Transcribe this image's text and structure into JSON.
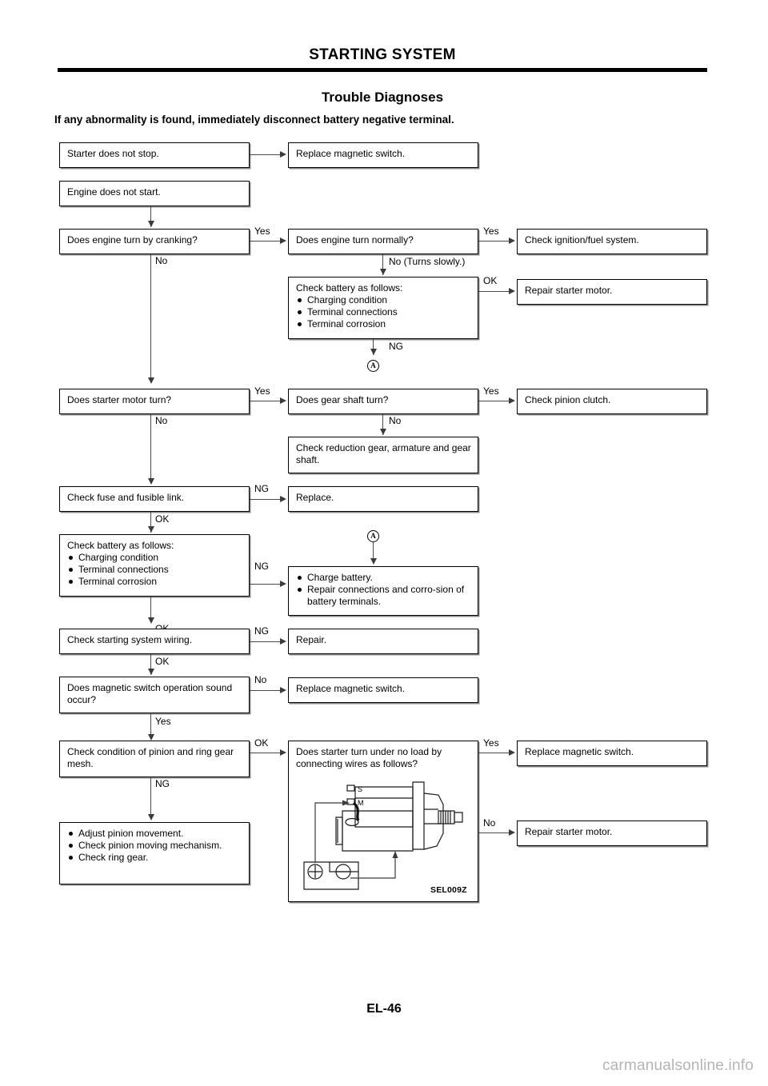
{
  "document": {
    "header_title": "STARTING SYSTEM",
    "section_title": "Trouble Diagnoses",
    "intro": "If any abnormality is found, immediately disconnect battery negative terminal.",
    "page_number": "EL-46",
    "watermark": "carmanualsonline.info"
  },
  "boxes": {
    "starter_does_not_stop": "Starter does not stop.",
    "replace_magnetic_switch_1": "Replace magnetic switch.",
    "engine_does_not_start": "Engine does not start.",
    "does_engine_turn_by_cranking": "Does engine turn by cranking?",
    "does_engine_turn_normally": "Does engine turn normally?",
    "check_ignition_fuel_system": "Check ignition/fuel system.",
    "check_battery_1_title": "Check battery as follows:",
    "check_battery_1_items": [
      "Charging condition",
      "Terminal connections",
      "Terminal corrosion"
    ],
    "repair_starter_motor_1": "Repair starter motor.",
    "does_starter_motor_turn": "Does starter motor turn?",
    "does_gear_shaft_turn": "Does gear shaft turn?",
    "check_pinion_clutch": "Check pinion clutch.",
    "check_reduction_gear": "Check reduction gear, armature and gear shaft.",
    "check_fuse_and_fusible_link": "Check fuse and fusible link.",
    "replace": "Replace.",
    "check_battery_2_title": "Check battery as follows:",
    "check_battery_2_items": [
      "Charging condition",
      "Terminal connections",
      "Terminal corrosion"
    ],
    "charge_battery_items": [
      "Charge battery.",
      "Repair connections and corro-­sion of battery terminals."
    ],
    "check_starting_system_wiring": "Check starting system wiring.",
    "repair": "Repair.",
    "does_magnetic_switch_sound": "Does magnetic switch operation sound occur?",
    "replace_magnetic_switch_2": "Replace magnetic switch.",
    "check_pinion_ring_gear_mesh": "Check condition of pinion and ring gear mesh.",
    "does_starter_turn_no_load": "Does starter turn under no load by connecting wires as follows?",
    "replace_magnetic_switch_3": "Replace magnetic switch.",
    "repair_starter_motor_2": "Repair starter motor.",
    "adjust_pinion_items": [
      "Adjust pinion movement.",
      "Check pinion moving mecha­nism.",
      "Check ring gear."
    ]
  },
  "labels": {
    "yes_1": "Yes",
    "no_1": "No",
    "yes_2": "Yes",
    "no_turns_slowly": "No (Turns slowly.)",
    "ok_1": "OK",
    "ng_1": "NG",
    "yes_3": "Yes",
    "no_2": "No",
    "yes_4": "Yes",
    "no_3": "No",
    "ng_2": "NG",
    "ok_2": "OK",
    "ng_3": "NG",
    "ok_3": "OK",
    "ng_4": "NG",
    "ok_4": "OK",
    "no_4": "No",
    "yes_5": "Yes",
    "ok_5": "OK",
    "ng_5": "NG",
    "yes_6": "Yes",
    "no_5": "No",
    "connector_a_1": "A",
    "connector_a_2": "A"
  },
  "illustration": {
    "code": "SEL009Z",
    "terminal_s": "S",
    "terminal_m": "M",
    "battery_positive": "⊕",
    "battery_negative": "⊖"
  },
  "colors": {
    "ink": "#000000",
    "line": "#4a4a4a",
    "shadow": "#8a8a8a",
    "watermark": "#b4b4b4"
  }
}
